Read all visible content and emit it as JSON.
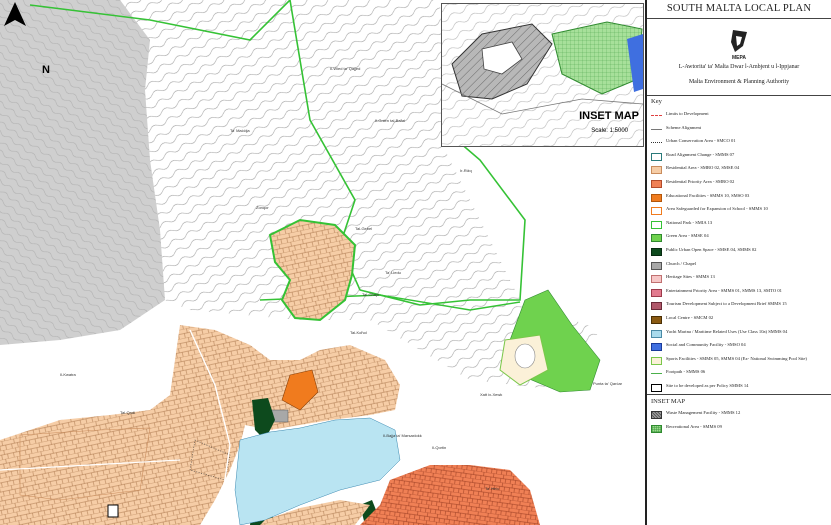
{
  "title": "SOUTH MALTA LOCAL PLAN",
  "logo_text": "MEPA",
  "authority_mt": "L-Awtorita' ta' Malta Dwar l-Ambjent u l-Ippjanar",
  "authority_en": "Malta Environment & Planning Authority",
  "north_label": "N",
  "inset": {
    "title": "INSET MAP",
    "scale": "Scale: 1:5000"
  },
  "key": {
    "title": "Key",
    "items": [
      {
        "label": "Limits to Development",
        "symbol": "dashed-line",
        "color": "#e04040"
      },
      {
        "label": "Scheme Alignment",
        "symbol": "line",
        "color": "#777777"
      },
      {
        "label": "Urban Conservation Area - SMCO 01",
        "symbol": "dotted-line",
        "color": "#333333"
      },
      {
        "label": "Road Alignment Change - SMMS 07",
        "symbol": "box",
        "color": "#ffffff",
        "border": "#2a7a7a"
      },
      {
        "label": "Residential Area - SMRO 02, SMSE 04",
        "symbol": "box",
        "color": "#f6cda6",
        "border": "#c98c5c"
      },
      {
        "label": "Residential Priority Area - SMRO 02",
        "symbol": "box",
        "color": "#f08055",
        "border": "#b24a2a"
      },
      {
        "label": "Educational Facilities - SMMS 10, SMSO 03",
        "symbol": "box",
        "color": "#f07b1e",
        "border": "#b2560a"
      },
      {
        "label": "Area Safeguarded for Expansion of School - SMMS 10",
        "symbol": "box",
        "color": "#ffffff",
        "border": "#f07b1e"
      },
      {
        "label": "National Park - SMIA 13",
        "symbol": "box",
        "color": "#ffffff",
        "border": "#35c235"
      },
      {
        "label": "Green Area - SMSE 04",
        "symbol": "box",
        "color": "#6fd24e",
        "border": "#2f8a2f"
      },
      {
        "label": "Public Urban Open Space - SMSE 04, SMMS 02",
        "symbol": "box",
        "color": "#0d4a1d",
        "border": "#062a10"
      },
      {
        "label": "Church / Chapel",
        "symbol": "box",
        "color": "#a8a8a8",
        "border": "#555555"
      },
      {
        "label": "Heritage Sites - SMMS 13",
        "symbol": "box",
        "color": "#f6c6c6",
        "border": "#c07070"
      },
      {
        "label": "Entertainment Priority Area - SMMS 01, SMMS 13, SMTO 01",
        "symbol": "box",
        "color": "#e27a8e",
        "border": "#9c3a4a"
      },
      {
        "label": "Tourism Development Subject to a Development Brief SMMS 15",
        "symbol": "box",
        "color": "#b0586a",
        "border": "#6a2a38"
      },
      {
        "label": "Local Centre - SMCM 02",
        "symbol": "box",
        "color": "#8a5a12",
        "border": "#4a2f05"
      },
      {
        "label": "Yacht Marina / Maritime Related Uses (Use Class 10a) SMMS 04",
        "symbol": "box",
        "color": "#a9daec",
        "border": "#4a8aa6"
      },
      {
        "label": "Social and Community Facility - SMSO 04",
        "symbol": "box",
        "color": "#3f6fe0",
        "border": "#1a3a9a"
      },
      {
        "label": "Sports Facilities - SMMS 05, SMMS 04 (Ex- National Swimming Pool Site)",
        "symbol": "box",
        "color": "#fbf1d8",
        "border": "#7ac74a"
      },
      {
        "label": "Footpath - SMMS 06",
        "symbol": "line",
        "color": "#4ab04a"
      },
      {
        "label": "Site to be developed as per Policy SMMS 14",
        "symbol": "box",
        "color": "#ffffff",
        "border": "#000000"
      }
    ]
  },
  "inset_key": {
    "title": "INSET MAP",
    "items": [
      {
        "label": "Waste Management Facility - SMMS 12",
        "symbol": "hatch",
        "color": "#9a9a9a",
        "border": "#333333"
      },
      {
        "label": "Recreational Area - SMMS 09",
        "symbol": "grid",
        "color": "#9bdc8c",
        "border": "#2f8a2f"
      }
    ]
  },
  "place_labels": [
    "Il-Wied ta' Qajjed",
    "Il-Gnien tal-Baħri",
    "Ta' Maċċija",
    "Ir-Riżq",
    "Żonqor",
    "Tal-Gebel",
    "Ta' Liedu",
    "Tal-Għajn",
    "Tal-Koħol",
    "Punta ta' Qarċar",
    "Xatt ix-Xewk",
    "Il-Bajja ta' Marsaxlokk",
    "Il-Kwatra",
    "Il-Qortin",
    "Ta' Ħelu",
    "Tal-Qadi"
  ],
  "colors": {
    "residential": "#f6cda6",
    "residential_priority": "#f08055",
    "education": "#f07b1e",
    "green": "#6fd24e",
    "open_space": "#0d4a1d",
    "grey_area": "#cfcfcf",
    "sea": "#b9e4f2",
    "national_park_outline": "#35c235",
    "footpath": "#4ab04a"
  }
}
